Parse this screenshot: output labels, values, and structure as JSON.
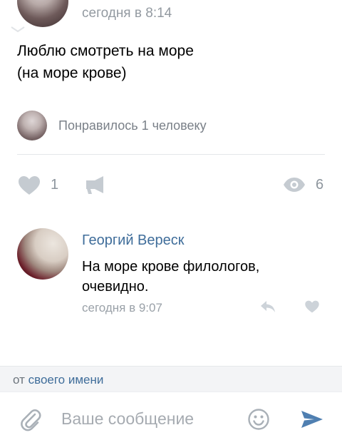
{
  "post": {
    "time": "сегодня в 8:14",
    "text_line1": "Люблю смотреть на море",
    "text_line2": "(на море крове)",
    "liked_by": "Понравилось 1 человеку",
    "like_count": "1",
    "view_count": "6"
  },
  "comment": {
    "author": "Георгий Вереск",
    "text_line1": "На море крове филологов,",
    "text_line2": "очевидно.",
    "time": "сегодня в 9:07"
  },
  "reply_as": {
    "prefix": "от",
    "link": "своего имени"
  },
  "composer": {
    "placeholder": "Ваше сообщение"
  },
  "icons": {
    "like": "heart-icon",
    "share": "megaphone-icon",
    "views": "eye-icon",
    "reply": "reply-arrow-icon",
    "attach": "paperclip-icon",
    "emoji": "smiley-icon",
    "send": "send-arrow-icon"
  },
  "colors": {
    "link": "#3f6d9a",
    "icon_gray": "#c5cbd1",
    "send": "#4f7fb1"
  }
}
